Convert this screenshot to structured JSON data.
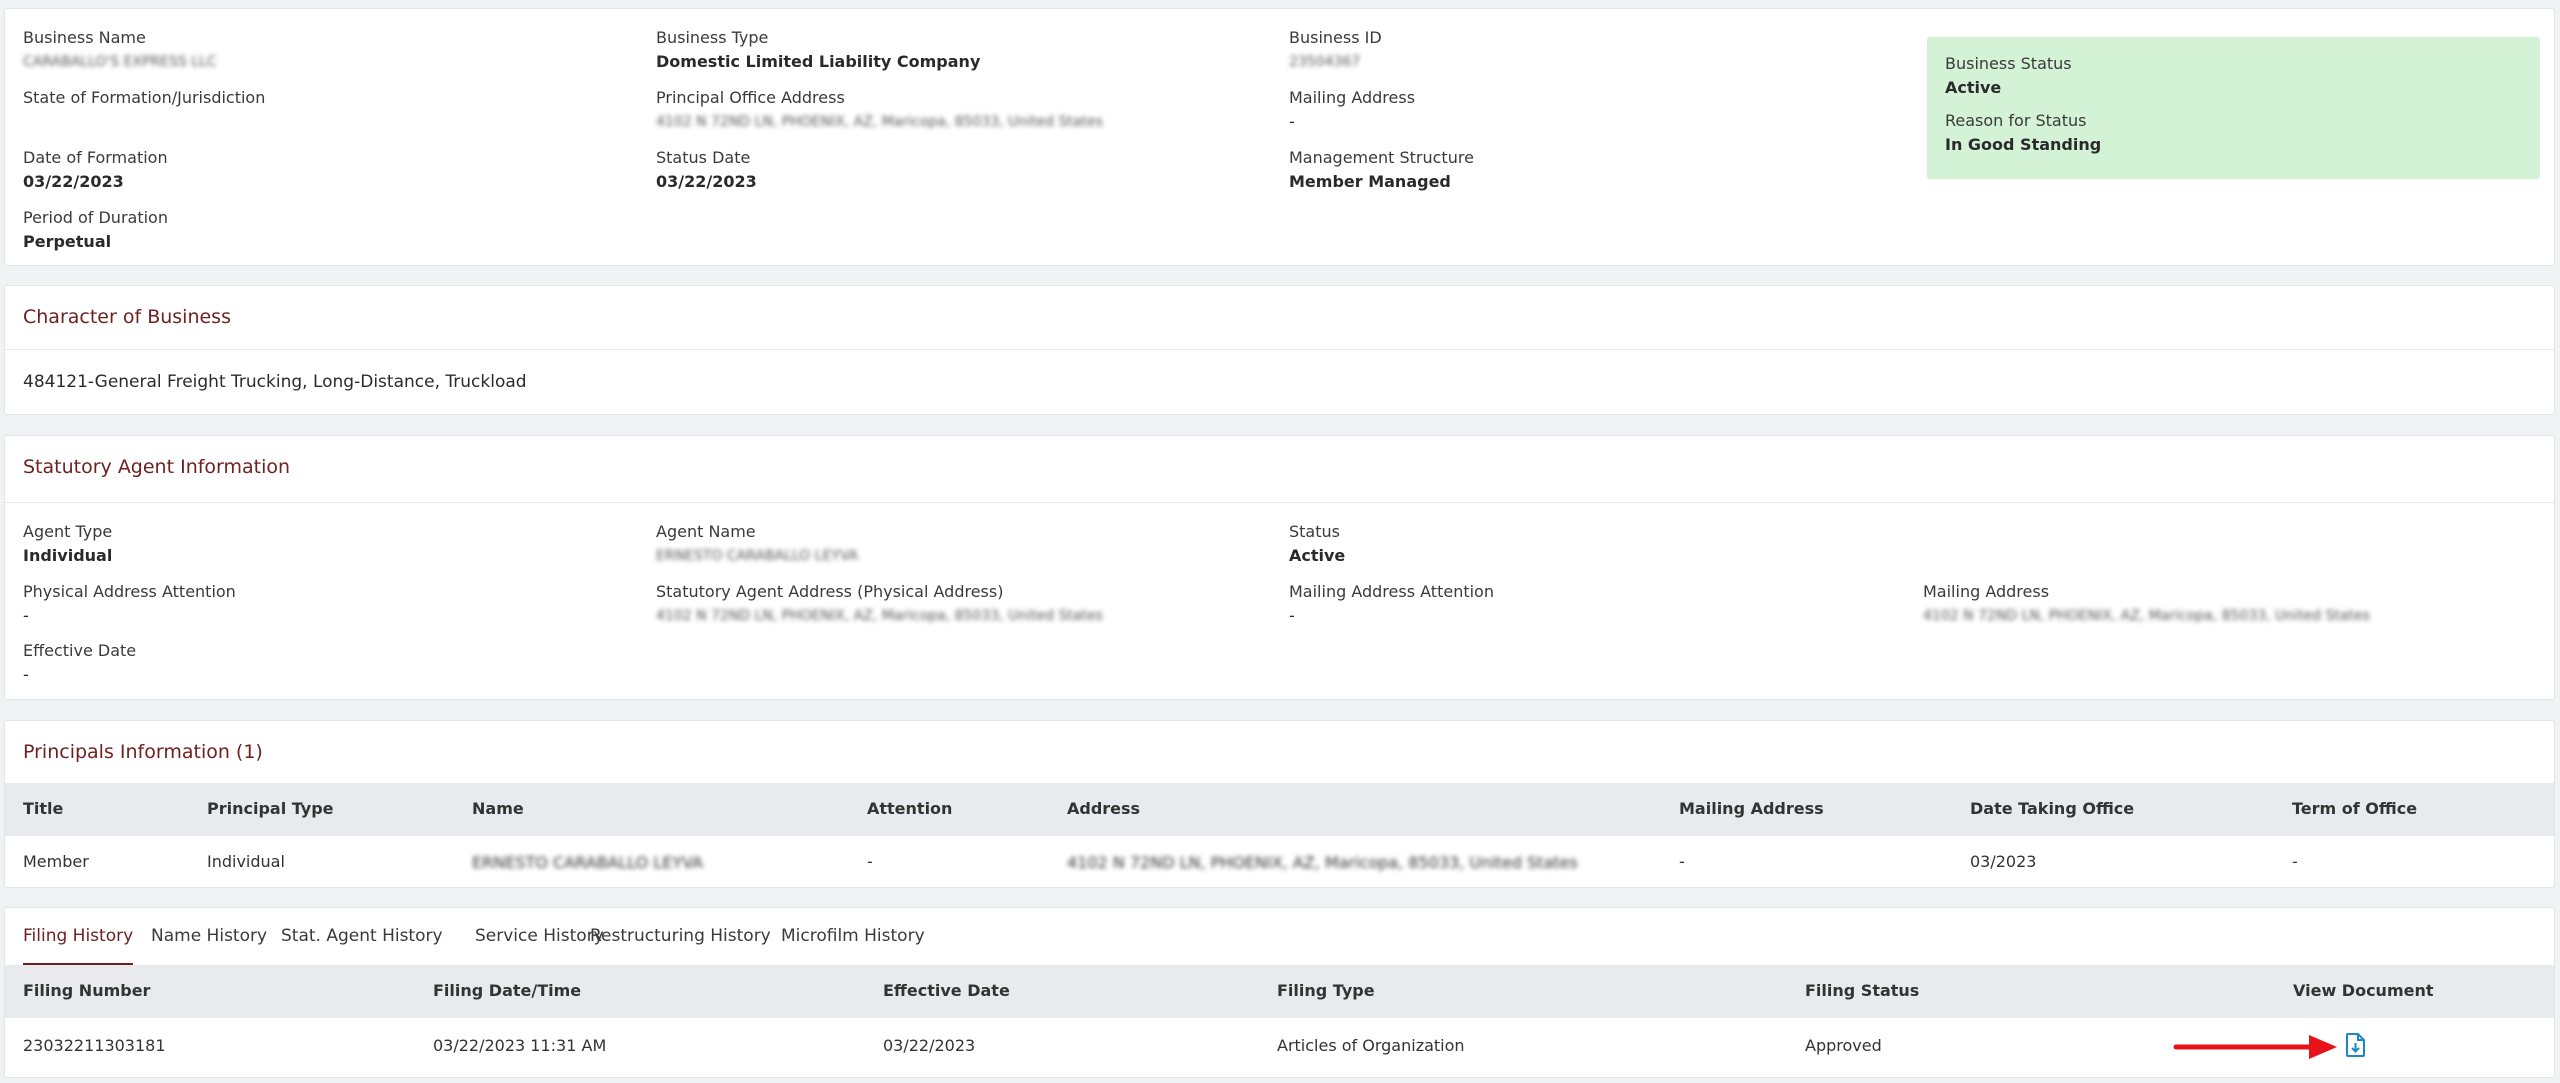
{
  "business": {
    "name_label": "Business Name",
    "name_value": "CARABALLO'S EXPRESS LLC",
    "type_label": "Business Type",
    "type_value": "Domestic Limited Liability Company",
    "id_label": "Business ID",
    "id_value": "23504367",
    "state_label": "State of Formation/Jurisdiction",
    "principal_office_label": "Principal Office Address",
    "principal_office_value": "4102 N 72ND LN, PHOENIX, AZ, Maricopa, 85033, United States",
    "mailing_label": "Mailing Address",
    "mailing_value": "-",
    "formation_date_label": "Date of Formation",
    "formation_date_value": "03/22/2023",
    "status_date_label": "Status Date",
    "status_date_value": "03/22/2023",
    "management_label": "Management Structure",
    "management_value": "Member Managed",
    "duration_label": "Period of Duration",
    "duration_value": "Perpetual",
    "status_label": "Business Status",
    "status_value": "Active",
    "reason_label": "Reason for Status",
    "reason_value": "In Good Standing",
    "status_box_color": "#d4f2d6"
  },
  "character": {
    "title": "Character of Business",
    "value": "484121-General Freight Trucking, Long-Distance, Truckload"
  },
  "agent": {
    "title": "Statutory Agent Information",
    "type_label": "Agent Type",
    "type_value": "Individual",
    "name_label": "Agent Name",
    "name_value": "ERNESTO CARABALLO LEYVA",
    "status_label": "Status",
    "status_value": "Active",
    "phys_attn_label": "Physical Address Attention",
    "phys_attn_value": "-",
    "phys_addr_label": "Statutory Agent Address (Physical Address)",
    "phys_addr_value": "4102 N 72ND LN, PHOENIX, AZ, Maricopa, 85033, United States",
    "mail_attn_label": "Mailing Address Attention",
    "mail_attn_value": "-",
    "mail_addr_label": "Mailing Address",
    "mail_addr_value": "4102 N 72ND LN, PHOENIX, AZ, Maricopa, 85033, United States",
    "effective_label": "Effective Date",
    "effective_value": "-"
  },
  "principals": {
    "title": "Principals Information (1)",
    "headers": [
      "Title",
      "Principal Type",
      "Name",
      "Attention",
      "Address",
      "Mailing Address",
      "Date Taking Office",
      "Term of Office"
    ],
    "rows": [
      [
        "Member",
        "Individual",
        "ERNESTO CARABALLO LEYVA",
        "-",
        "4102 N 72ND LN, PHOENIX, AZ, Maricopa, 85033, United States",
        "-",
        "03/2023",
        "-"
      ]
    ]
  },
  "history": {
    "tabs": [
      "Filing History",
      "Name History",
      "Stat. Agent History",
      "Service History",
      "Restructuring History",
      "Microfilm History"
    ],
    "active_tab": 0,
    "headers": [
      "Filing Number",
      "Filing Date/Time",
      "Effective Date",
      "Filing Type",
      "Filing Status",
      "View Document"
    ],
    "rows": [
      [
        "23032211303181",
        "03/22/2023 11:31 AM",
        "03/22/2023",
        "Articles of Organization",
        "Approved"
      ]
    ],
    "view_icon": "document-download-icon",
    "accent_color": "#6e1f1f",
    "arrow_color": "#e8121b",
    "icon_color": "#1a88c9"
  }
}
